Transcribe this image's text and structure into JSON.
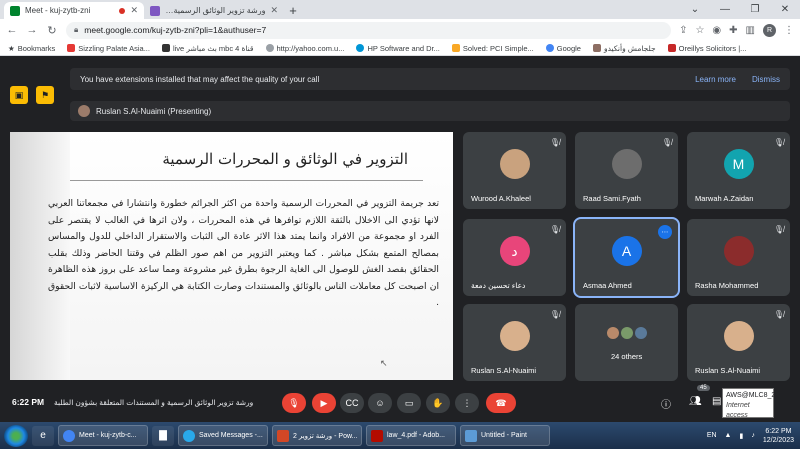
{
  "browser": {
    "tabs": [
      {
        "label": "Meet - kuj-zytb-zni",
        "active": true,
        "color": "#00832d"
      },
      {
        "label": "ورشة تزوير الوثائق الرسمية و المستندات المتعلقة",
        "active": false,
        "color": "#7e57c2"
      }
    ],
    "url": "meet.google.com/kuj-zytb-zni?pli=1&authuser=7",
    "profile_initial": "R"
  },
  "bookmarks": [
    {
      "label": "Bookmarks",
      "color": "#5f6368"
    },
    {
      "label": "Sizzling Palate Asia...",
      "color": "#e53935"
    },
    {
      "label": "live بث مباشر mbc 4 قناة",
      "color": "#333333"
    },
    {
      "label": "http://yahoo.com.u...",
      "color": "#6001d2"
    },
    {
      "label": "HP Software and Dr...",
      "color": "#0096d6"
    },
    {
      "label": "Solved: PCI Simple...",
      "color": "#f9a825"
    },
    {
      "label": "Google",
      "color": "#4285f4"
    },
    {
      "label": "جلجامش وأنكيدو",
      "color": "#8d6e63"
    },
    {
      "label": "Oreillys Solicitors |...",
      "color": "#c62828"
    }
  ],
  "meet": {
    "warning": "You have extensions installed that may affect the quality of your call",
    "learn_more": "Learn more",
    "dismiss": "Dismiss",
    "presenting": "Ruslan S.Al-Nuaimi (Presenting)",
    "slide": {
      "title": "التزوير في الوثائق و المحررات الرسمية",
      "body": "تعد جريمة التزوير في المحررات الرسمية واحدة من اكثر الجرائم خطورة وانتشارا في مجمعاتنا العربي لانها تؤدي الى الاخلال بالثقة اللازم توافرها في هذه المحررات ، ولان اثرها في الغالب لا يقتصر على الفرد او مجموعة من الافراد وانما يمتد هذا الاثر عادة الى الثبات والاستقرار الداخلي للدول والمساس بمصالح المتمع بشكل مباشر . كما ويعتبر التزوير من اهم صور الظلم في وقتنا الحاضر وذلك بقلب الحقائق بقصد الغش للوصول الى الغاية الرجوة بطرق غير مشروعة ومما ساعد على بروز هذه الظاهرة ان اصبحت كل معاملات الناس بالوثائق والمستندات وصارت الكتابة هي الركيزة الاساسية لاثبات الحقوق ."
    },
    "tiles": [
      {
        "name": "Wurood A.Khaleel",
        "type": "photo",
        "color": "#c9a27e"
      },
      {
        "name": "Raad Sami.Fyath",
        "type": "photo",
        "color": "#6d6d6d"
      },
      {
        "name": "Marwah A.Zaidan",
        "type": "initial",
        "initial": "M",
        "color": "#12a4af"
      },
      {
        "name": "دعاء تحسين دمعة",
        "type": "initial",
        "initial": "د",
        "color": "#e8457a"
      },
      {
        "name": "Asmaa Ahmed",
        "type": "initial",
        "initial": "A",
        "color": "#1a73e8",
        "speaking": true
      },
      {
        "name": "Rasha Mohammed",
        "type": "photo",
        "color": "#8b2c2c"
      },
      {
        "name": "Ruslan S.Al-Nuaimi",
        "type": "photo",
        "color": "#d8b08c"
      },
      {
        "name": "24 others",
        "type": "others"
      },
      {
        "name": "Ruslan S.Al-Nuaimi",
        "type": "photo",
        "color": "#d8b08c"
      }
    ],
    "bottom": {
      "time": "6:22 PM",
      "meeting_name": "ورشة تزوير الوثائق الرسمية و المستندات المتعلقة بشؤون الطلبة",
      "participant_count": "45",
      "tooltip_line1": "AWS@MLC8_2",
      "tooltip_line2": "Internet access"
    }
  },
  "taskbar": {
    "buttons": [
      {
        "label": "Meet - kuj-zytb-c...",
        "color": "#4285f4"
      },
      {
        "label": "Saved Messages -...",
        "color": "#29a9eb"
      },
      {
        "label": "ورشة تزوير 2 - Pow...",
        "color": "#d24726"
      },
      {
        "label": "law_4.pdf - Adob...",
        "color": "#b30b00"
      },
      {
        "label": "Untitled - Paint",
        "color": "#5c9bd6"
      }
    ],
    "lang": "EN",
    "time": "6:22 PM",
    "date": "12/2/2023"
  }
}
